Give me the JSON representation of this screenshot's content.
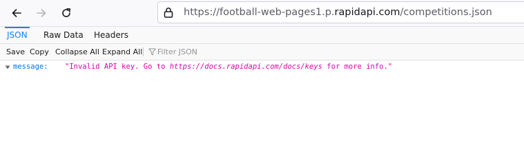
{
  "browser": {
    "url": {
      "prefix": "https://football-web-pages1.p.",
      "host": "rapidapi.com",
      "suffix": "/competitions.json"
    },
    "icons": {
      "back": "arrow-left-icon",
      "forward": "arrow-right-icon",
      "reload": "reload-icon",
      "lock": "lock-icon"
    }
  },
  "json_viewer": {
    "tabs": [
      {
        "label": "JSON",
        "selected": true
      },
      {
        "label": "Raw Data",
        "selected": false
      },
      {
        "label": "Headers",
        "selected": false
      }
    ],
    "toolbar": {
      "save_label": "Save",
      "copy_label": "Copy",
      "collapse_label": "Collapse All",
      "expand_label": "Expand All",
      "filter_placeholder": "Filter JSON"
    },
    "rows": [
      {
        "key": "message:",
        "value_prefix": "\"Invalid API key. Go to ",
        "value_link": "https://docs.rapidapi.com/docs/keys",
        "value_suffix": " for more info.\""
      }
    ],
    "colors": {
      "accent": "#0a84ff",
      "key": "#0074e8",
      "string": "#dd00a9"
    }
  }
}
